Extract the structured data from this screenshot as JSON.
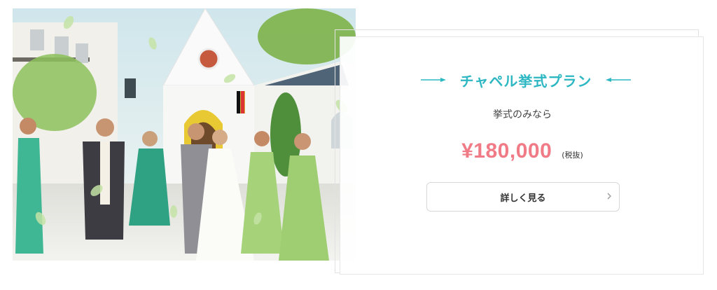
{
  "plan": {
    "title": "チャペル挙式プラン",
    "subtitle": "挙式のみなら",
    "price": "¥180,000",
    "tax_note": "(税抜)",
    "detail_button": "詳しく見る"
  },
  "photo": {
    "description_icon": "chapel-wedding-photo"
  },
  "colors": {
    "accent": "#2cb7c2",
    "price": "#f07b86",
    "border": "#e6e6e6"
  },
  "icons": {
    "title_left": "flourish-left-icon",
    "title_right": "flourish-right-icon",
    "button_arrow": "chevron-right-icon"
  }
}
